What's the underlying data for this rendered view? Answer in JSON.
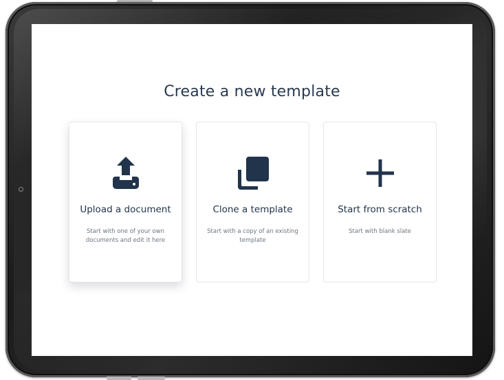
{
  "page": {
    "title": "Create a new template"
  },
  "options": [
    {
      "title": "Upload a document",
      "description": "Start with one of your own documents and edit it here",
      "icon": "upload-icon",
      "selected": true
    },
    {
      "title": "Clone a template",
      "description": "Start with a copy of an existing template",
      "icon": "clone-icon",
      "selected": false
    },
    {
      "title": "Start from scratch",
      "description": "Start with blank slate",
      "icon": "plus-icon",
      "selected": false
    }
  ],
  "colors": {
    "icon": "#22344b",
    "title": "#2a3a4f",
    "description": "#6c7682",
    "card_border": "#e4e6ea"
  }
}
